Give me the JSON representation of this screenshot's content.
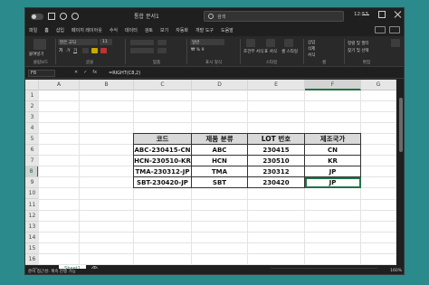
{
  "window": {
    "title": "통합 문서1",
    "clock": "12:53"
  },
  "search": {
    "placeholder": "검색"
  },
  "menu": {
    "tabs": [
      "파일",
      "홈",
      "삽입",
      "페이지 레이아웃",
      "수식",
      "데이터",
      "검토",
      "보기",
      "자동화",
      "개발 도구",
      "도움말"
    ],
    "active_index": 1
  },
  "ribbon": {
    "paste": "붙여넣기",
    "clipboard": "클립보드",
    "font_name": "맑은 고딕",
    "font_size": "11",
    "font_group": "글꼴",
    "align_group": "맞춤",
    "wrap": "일반",
    "number_group": "표시 형식",
    "cond": "조건부 서식",
    "as_table": "표 서식",
    "cell_style": "셀 스타일",
    "style_group": "스타일",
    "insert": "삽입",
    "delete": "삭제",
    "format": "서식",
    "cells_group": "셀",
    "sort": "정렬 및 필터",
    "find": "찾기 및 선택",
    "edit_group": "편집",
    "addins": "추가 기능",
    "addins_group": "추가 기능"
  },
  "formula_bar": {
    "name_box": "F8",
    "formula": "=RIGHT(C8,2)"
  },
  "columns": [
    "A",
    "B",
    "C",
    "D",
    "E",
    "F",
    "G",
    "H"
  ],
  "selected_column": "F",
  "rows": [
    "1",
    "2",
    "3",
    "4",
    "5",
    "6",
    "7",
    "8",
    "9",
    "10",
    "11",
    "12",
    "13",
    "14",
    "15",
    "16"
  ],
  "selected_row": "8",
  "table": {
    "headers": [
      "코드",
      "제품 분류",
      "LOT 번호",
      "제조국가"
    ],
    "rows": [
      [
        "ABC-230415-CN",
        "ABC",
        "230415",
        "CN"
      ],
      [
        "HCN-230510-KR",
        "HCN",
        "230510",
        "KR"
      ],
      [
        "TMA-230312-JP",
        "TMA",
        "230312",
        "JP"
      ],
      [
        "SBT-230420-JP",
        "SBT",
        "230420",
        "JP"
      ]
    ]
  },
  "sheets": {
    "tab": "Sheet1"
  },
  "status": {
    "left": "준비  접근성: 계속 진행 가능",
    "zoom": "160%"
  },
  "colors": {
    "accent": "#217346",
    "chrome": "#1f1f1f"
  }
}
